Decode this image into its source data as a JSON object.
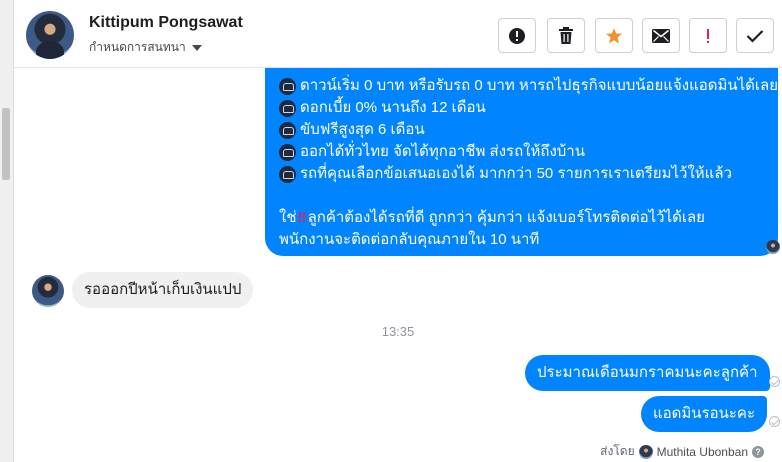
{
  "header": {
    "name": "Kittipum Pongsawat",
    "assign_label": "กำหนดการสนทนา",
    "tools": [
      {
        "icon": "alert-circle-icon",
        "label": "Mark as spam"
      },
      {
        "icon": "trash-icon",
        "label": "Delete"
      },
      {
        "icon": "star-icon",
        "label": "Star"
      },
      {
        "icon": "envelope-icon",
        "label": "Mark as unread"
      },
      {
        "icon": "exclamation-icon",
        "label": "Follow up"
      },
      {
        "icon": "checkmark-icon",
        "label": "Mark as done"
      }
    ],
    "accent_star": "#f0932b",
    "accent_red": "#e0245e"
  },
  "messages": {
    "outgoing_big": {
      "lines": [
        "ดาวน์เริ่ม 0 บาท หรือรับรถ 0 บาท หารถไปธุรกิจแบบน้อยแจ้งแอดมินได้เลย",
        "ดอกเบี้ย 0% นานถึง 12 เดือน",
        "ขับฟรีสูงสุด 6 เดือน",
        "ออกได้ทั่วไทย จัดได้ทุกอาชีพ ส่งรถให้ถึงบ้าน",
        "รถที่คุณเลือกข้อเสนอเองได้ มากกว่า 50 รายการเราเตรียมไว้ให้แล้ว"
      ],
      "closing_prefix": "ใช่",
      "closing_mark": "‼",
      "closing_rest": " ลูกค้าต้องได้รถที่ดี ถูกกว่า คุ้มกว่า แจ้งเบอร์โทรติดต่อไว้ได้เลย",
      "closing_line2": "พนักงานจะติดต่อกลับคุณภายใน 10 นาที"
    },
    "incoming": "รอออกปีหน้าเก็บเงินแปป",
    "timestamp": "13:35",
    "outgoing_1": "ประมาณเดือนมกราคมนะคะลูกค้า",
    "outgoing_2": "แอดมินรอนะคะ",
    "sent_by_label": "ส่งโดย",
    "sent_by_agent": "Muthita Ubonban",
    "help_glyph": "?"
  },
  "colors": {
    "bubble_blue": "#0084ff",
    "bubble_gray": "#f1f0f0"
  }
}
